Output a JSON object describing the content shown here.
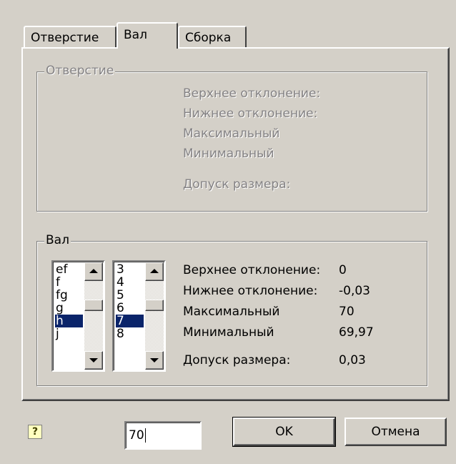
{
  "tabs": [
    {
      "label": "Отверстие",
      "active": false
    },
    {
      "label": "Вал",
      "active": true
    },
    {
      "label": "Сборка",
      "active": false
    }
  ],
  "hole_group": {
    "title": "Отверстие",
    "labels": [
      "Верхнее отклонение:",
      "Нижнее отклонение:",
      "Максимальный",
      "Минимальный",
      "Допуск размера:"
    ]
  },
  "shaft_group": {
    "title": "Вал",
    "letter_list": {
      "items": [
        "ef",
        "f",
        "fg",
        "g",
        "h",
        "j"
      ],
      "selected": "h"
    },
    "grade_list": {
      "items": [
        "3",
        "4",
        "5",
        "6",
        "7",
        "8"
      ],
      "selected": "7"
    },
    "rows": [
      {
        "label": "Верхнее отклонение:",
        "value": "0"
      },
      {
        "label": "Нижнее отклонение:",
        "value": "-0,03"
      },
      {
        "label": "Максимальный",
        "value": "70"
      },
      {
        "label": "Минимальный",
        "value": "69,97"
      },
      {
        "label": "Допуск размера:",
        "value": "0,03"
      }
    ]
  },
  "size_input": {
    "value": "70"
  },
  "buttons": {
    "ok": "OK",
    "cancel": "Отмена"
  },
  "help_icon": "help-icon",
  "colors": {
    "selection": "#0a246a",
    "dialog_bg": "#d4d0c8",
    "disabled_text": "#848284"
  }
}
